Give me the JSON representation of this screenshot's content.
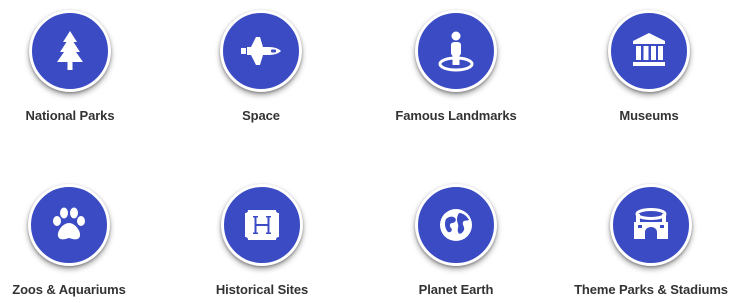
{
  "colors": {
    "icon_background": "#3b4bc4",
    "icon_glyph": "#ffffff",
    "label_text": "#333333"
  },
  "categories": [
    {
      "label": "National Parks",
      "icon": "pine-tree-icon"
    },
    {
      "label": "Space",
      "icon": "space-shuttle-icon"
    },
    {
      "label": "Famous Landmarks",
      "icon": "person-on-landmark-icon"
    },
    {
      "label": "Museums",
      "icon": "museum-building-icon"
    },
    {
      "label": "Zoos & Aquariums",
      "icon": "paw-icon"
    },
    {
      "label": "Historical Sites",
      "icon": "historical-marker-h-icon"
    },
    {
      "label": "Planet Earth",
      "icon": "globe-icon"
    },
    {
      "label": "Theme Parks & Stadiums",
      "icon": "stadium-icon"
    }
  ]
}
